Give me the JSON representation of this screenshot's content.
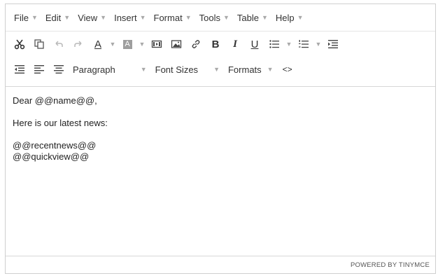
{
  "menubar": {
    "items": [
      {
        "label": "File"
      },
      {
        "label": "Edit"
      },
      {
        "label": "View"
      },
      {
        "label": "Insert"
      },
      {
        "label": "Format"
      },
      {
        "label": "Tools"
      },
      {
        "label": "Table"
      },
      {
        "label": "Help"
      }
    ]
  },
  "toolbar": {
    "text_color_glyph": "A",
    "bg_color_glyph": "A",
    "bold_glyph": "B",
    "italic_glyph": "I",
    "underline_glyph": "U",
    "code_glyph": "<>",
    "block_format": "Paragraph",
    "font_sizes": "Font Sizes",
    "formats": "Formats"
  },
  "content": {
    "lines": [
      "Dear @@name@@,",
      "Here is our latest news:",
      "@@recentnews@@",
      "@@quickview@@"
    ]
  },
  "statusbar": {
    "branding": "POWERED BY TINYMCE"
  },
  "icons": {
    "cut": "scissors-icon",
    "copy": "copy-icon",
    "undo": "undo-icon",
    "redo": "redo-icon",
    "media": "media-icon",
    "image": "image-icon",
    "link": "link-icon",
    "bullist": "bullet-list-icon",
    "numlist": "numbered-list-icon",
    "indent": "indent-icon",
    "outdent": "outdent-icon",
    "align_left": "align-left-icon",
    "align_center": "align-center-icon"
  },
  "colors": {
    "border": "#cfcfcf",
    "text": "#333333",
    "caret": "#a9a9a9"
  }
}
